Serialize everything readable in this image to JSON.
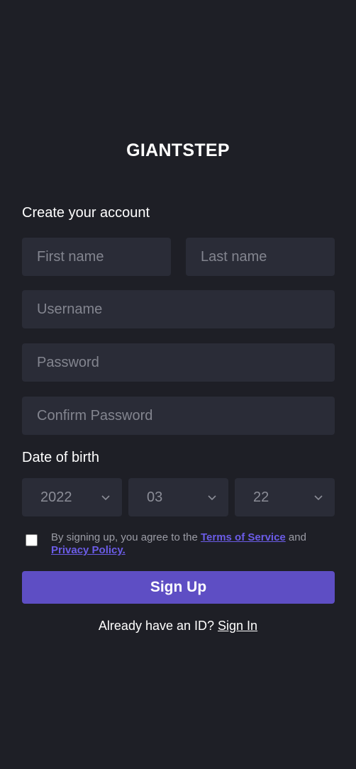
{
  "brand": {
    "logo_text": "GIANTSTEP"
  },
  "form": {
    "heading": "Create your account",
    "first_name": {
      "placeholder": "First name",
      "value": ""
    },
    "last_name": {
      "placeholder": "Last name",
      "value": ""
    },
    "username": {
      "placeholder": "Username",
      "value": ""
    },
    "password": {
      "placeholder": "Password",
      "value": ""
    },
    "confirm_password": {
      "placeholder": "Confirm Password",
      "value": ""
    },
    "dob": {
      "label": "Date of birth",
      "year": "2022",
      "month": "03",
      "day": "22"
    },
    "agreement": {
      "checked": false,
      "prefix": "By signing up, you agree to the ",
      "terms_link": "Terms of Service",
      "middle": " and ",
      "privacy_link": "Privacy Policy."
    },
    "signup_label": "Sign Up",
    "signin_prompt": "Already have an ID? ",
    "signin_link": "Sign In"
  },
  "colors": {
    "background": "#1e1f26",
    "field": "#2a2c37",
    "accent": "#5e4ec4",
    "link": "#6b5ce7"
  },
  "icons": {
    "select_caret": "chevron-down-icon"
  }
}
